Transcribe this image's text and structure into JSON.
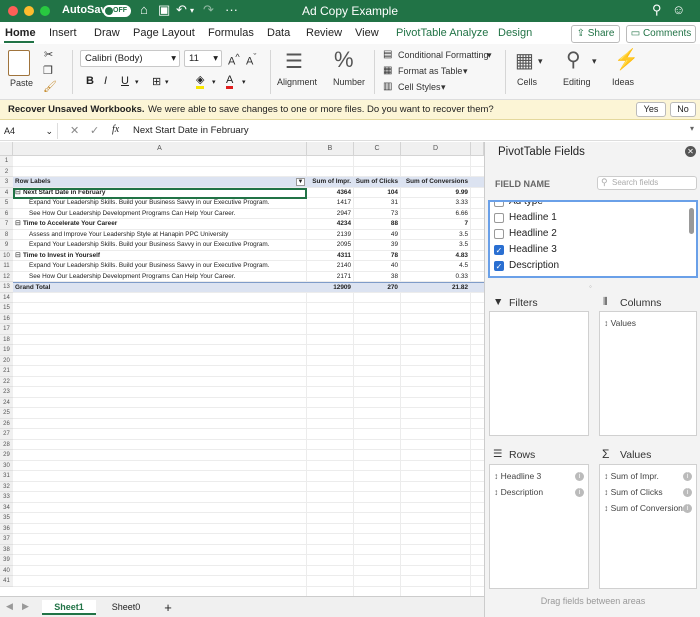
{
  "window": {
    "title": "Ad Copy Example",
    "autosave_label": "AutoSave",
    "autosave_state": "OFF"
  },
  "tabs": [
    "Home",
    "Insert",
    "Draw",
    "Page Layout",
    "Formulas",
    "Data",
    "Review",
    "View",
    "PivotTable Analyze",
    "Design"
  ],
  "share_label": "Share",
  "comments_label": "Comments",
  "ribbon": {
    "paste": "Paste",
    "font_name": "Calibri (Body)",
    "font_size": "11",
    "alignment": "Alignment",
    "number": "Number",
    "conditional_formatting": "Conditional Formatting",
    "format_as_table": "Format as Table",
    "cell_styles": "Cell Styles",
    "cells": "Cells",
    "editing": "Editing",
    "ideas": "Ideas"
  },
  "infobar": {
    "title": "Recover Unsaved Workbooks.",
    "message": "We were able to save changes to one or more files. Do you want to recover them?",
    "yes": "Yes",
    "no": "No"
  },
  "formula": {
    "name_box": "A4",
    "fx": "fx",
    "content": "Next Start Date in February"
  },
  "columns": [
    "A",
    "B",
    "C",
    "D"
  ],
  "row_numbers": [
    "1",
    "2",
    "3",
    "4",
    "5",
    "6",
    "7",
    "8",
    "9",
    "10",
    "11",
    "12",
    "13",
    "14",
    "15",
    "16",
    "17",
    "18",
    "19",
    "20",
    "21",
    "22",
    "23",
    "24",
    "25",
    "26",
    "27",
    "28",
    "29",
    "30",
    "31",
    "32",
    "33",
    "34",
    "35",
    "36",
    "37",
    "38",
    "39",
    "40",
    "41"
  ],
  "pivot": {
    "headers": [
      "Row Labels",
      "Sum of Impr.",
      "Sum of Clicks",
      "Sum of Conversions"
    ],
    "rows": [
      {
        "label": "Next Start Date in February",
        "impr": "4364",
        "clicks": "104",
        "conv": "9.99",
        "level": 0
      },
      {
        "label": "Expand Your Leadership Skills. Build your Business Savvy in our Executive Program.",
        "impr": "1417",
        "clicks": "31",
        "conv": "3.33",
        "level": 1
      },
      {
        "label": "See How Our Leadership Development Programs Can Help Your Career.",
        "impr": "2947",
        "clicks": "73",
        "conv": "6.66",
        "level": 1
      },
      {
        "label": "Time to Accelerate Your Career",
        "impr": "4234",
        "clicks": "88",
        "conv": "7",
        "level": 0
      },
      {
        "label": "Assess and Improve Your Leadership Style at Hanapin PPC University",
        "impr": "2139",
        "clicks": "49",
        "conv": "3.5",
        "level": 1
      },
      {
        "label": "Expand Your Leadership Skills. Build your Business Savvy in our Executive Program.",
        "impr": "2095",
        "clicks": "39",
        "conv": "3.5",
        "level": 1
      },
      {
        "label": "Time to Invest in Yourself",
        "impr": "4311",
        "clicks": "78",
        "conv": "4.83",
        "level": 0
      },
      {
        "label": "Expand Your Leadership Skills. Build your Business Savvy in our Executive Program.",
        "impr": "2140",
        "clicks": "40",
        "conv": "4.5",
        "level": 1
      },
      {
        "label": "See How Our Leadership Development Programs Can Help Your Career.",
        "impr": "2171",
        "clicks": "38",
        "conv": "0.33",
        "level": 1
      }
    ],
    "grand_total": {
      "label": "Grand Total",
      "impr": "12909",
      "clicks": "270",
      "conv": "21.82"
    }
  },
  "sheets": [
    "Sheet1",
    "Sheet0"
  ],
  "panel": {
    "title": "PivotTable Fields",
    "field_name_label": "FIELD NAME",
    "search_placeholder": "Search fields",
    "fields": [
      {
        "label": "Ad type",
        "checked": false
      },
      {
        "label": "Headline 1",
        "checked": false
      },
      {
        "label": "Headline 2",
        "checked": false
      },
      {
        "label": "Headline 3",
        "checked": true
      },
      {
        "label": "Description",
        "checked": true
      }
    ],
    "filters": "Filters",
    "columns": "Columns",
    "column_items": [
      "Values"
    ],
    "rows": "Rows",
    "row_items": [
      "Headline 3",
      "Description"
    ],
    "values": "Values",
    "value_items": [
      "Sum of Impr.",
      "Sum of Clicks",
      "Sum of Conversions"
    ],
    "footer": "Drag fields between areas"
  }
}
